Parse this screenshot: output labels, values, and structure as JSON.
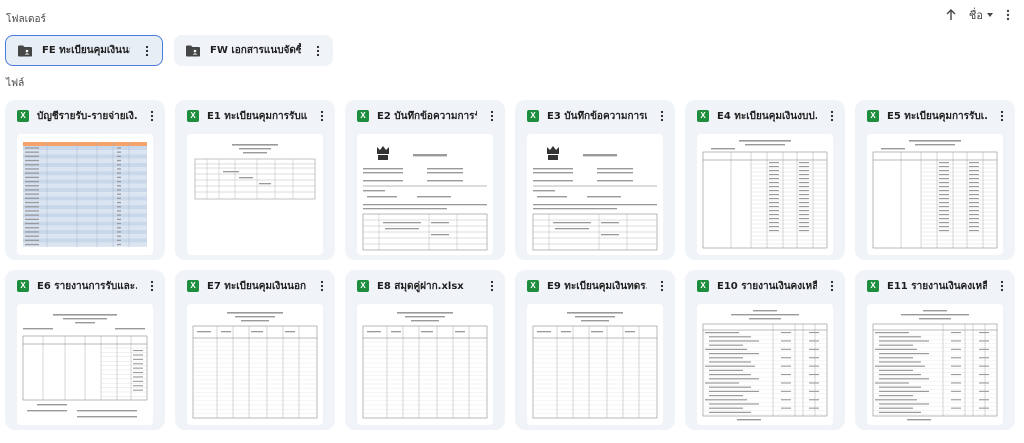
{
  "sections": {
    "folders": "โฟลเดอร์",
    "files": "ไฟล์"
  },
  "toolbar": {
    "sort_label": "ชื่อ"
  },
  "folders": [
    {
      "name": "FE ทะเบียนคุมเงินนอก...",
      "selected": true
    },
    {
      "name": "FW เอกสารแนบจัดซื้อ...",
      "selected": false
    }
  ],
  "files": [
    {
      "name": "บัญชีรายรับ-รายจ่ายเงิ...",
      "icon": "X",
      "thumb": "spreadsheet-blue"
    },
    {
      "name": "E1 ทะเบียนคุมการรับแ...",
      "icon": "X",
      "thumb": "form-sparse"
    },
    {
      "name": "E2 บันทึกข้อความการรั...",
      "icon": "X",
      "thumb": "memo"
    },
    {
      "name": "E3 บันทึกข้อความการเ...",
      "icon": "X",
      "thumb": "memo"
    },
    {
      "name": "E4 ทะเบียนคุมเงินงบป...",
      "icon": "X",
      "thumb": "table-dense"
    },
    {
      "name": "E5 ทะเบียนคุมการรับเ...",
      "icon": "X",
      "thumb": "table-dense"
    },
    {
      "name": "E6 รายงานการรับและ...",
      "icon": "X",
      "thumb": "report"
    },
    {
      "name": "E7 ทะเบียนคุมเงินนอก...",
      "icon": "X",
      "thumb": "table-grid"
    },
    {
      "name": "E8 สมุดคู่ฝาก.xlsx",
      "icon": "X",
      "thumb": "table-grid"
    },
    {
      "name": "E9 ทะเบียนคุมเงินทดร...",
      "icon": "X",
      "thumb": "table-grid"
    },
    {
      "name": "E10 รายงานเงินคงเหลื...",
      "icon": "X",
      "thumb": "list-report"
    },
    {
      "name": "E11 รายงานเงินคงเหลือ...",
      "icon": "X",
      "thumb": "list-report"
    }
  ],
  "colors": {
    "accent": "#4b7bd8",
    "excel": "#1e8e3e",
    "card_bg": "#f0f4f9",
    "sheet_header": "#f4a36b",
    "sheet_row": "#c8d7ea"
  }
}
